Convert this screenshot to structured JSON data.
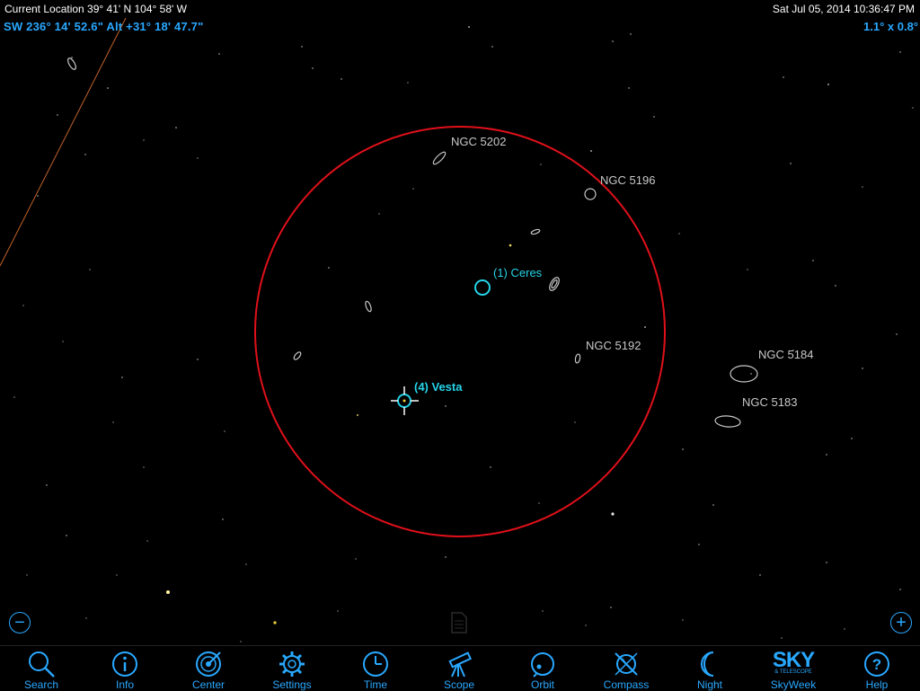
{
  "status": {
    "location": "Current Location  39° 41' N 104° 58' W",
    "datetime": "Sat Jul 05, 2014  10:36:47 PM"
  },
  "coords": "SW 236° 14' 52.6\" Alt +31° 18' 47.7\"",
  "fov": "1.1° x  0.8°",
  "labels": {
    "ngc5202": "NGC 5202",
    "ngc5196": "NGC 5196",
    "ceres": "(1) Ceres",
    "ngc5192": "NGC 5192",
    "vesta": "(4) Vesta",
    "ngc5184": "NGC 5184",
    "ngc5183": "NGC 5183"
  },
  "zoom": {
    "out": "−",
    "in": "+"
  },
  "toolbar": {
    "search": "Search",
    "info": "Info",
    "center": "Center",
    "settings": "Settings",
    "time": "Time",
    "scope": "Scope",
    "orbit": "Orbit",
    "compass": "Compass",
    "night": "Night",
    "skyweek": "SkyWeek",
    "help": "Help",
    "sky_logo": "SKY",
    "sky_logo_sub": "& TELESCOPE"
  },
  "colors": {
    "accent": "#29a8ff",
    "fov_circle": "#e0101a",
    "object_label": "#c8c8c8",
    "asteroid": "#25d4e8"
  },
  "icons": [
    "search-icon",
    "info-icon",
    "target-icon",
    "gear-icon",
    "clock-icon",
    "telescope-icon",
    "orbit-icon",
    "compass-icon",
    "moon-icon",
    "help-icon"
  ]
}
